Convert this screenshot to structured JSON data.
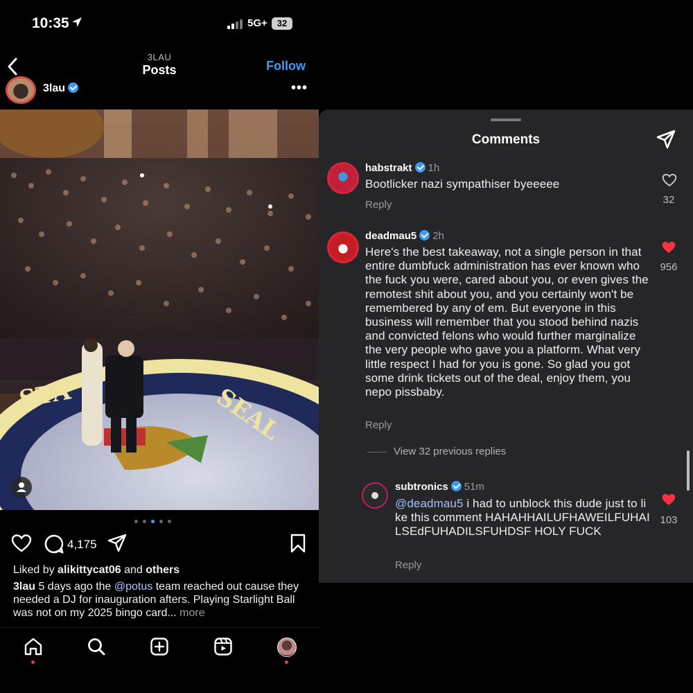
{
  "status_bar": {
    "time": "10:35",
    "network": "5G+",
    "battery": "32"
  },
  "header": {
    "subtitle": "3LAU",
    "title": "Posts",
    "follow_label": "Follow"
  },
  "post": {
    "author": "3lau",
    "more_label": "•••",
    "comment_count": "4,175",
    "liked_prefix": "Liked by ",
    "liked_user": "alikittycat06",
    "liked_mid": " and ",
    "liked_others": "others",
    "caption_user": "3lau",
    "caption_part1": " 5 days ago the ",
    "caption_mention": "@potus",
    "caption_part2": " team reached out cause they needed a DJ for inauguration afters. Playing Starlight Ball was not on my 2025 bingo card...",
    "caption_more": " more",
    "carousel_total": 5,
    "carousel_active": 2
  },
  "comments_panel": {
    "title": "Comments",
    "view_replies": "View 32 previous replies",
    "items": [
      {
        "user": "habstrakt",
        "time": "1h",
        "text": "Bootlicker nazi sympathiser byeeeee",
        "reply_label": "Reply",
        "likes": "32",
        "liked": false
      },
      {
        "user": "deadmau5",
        "time": "2h",
        "text": "Here's the best takeaway, not a single person in that entire dumbfuck administration has ever known who the fuck you were, cared about you, or even gives the remotest shit about you, and you certainly won't be remembered by any of em. But everyone in this business will remember that you stood behind nazis and convicted felons who would further marginalize the very people who gave you a platform. What very little respect I had for you is gone.  So glad you got some drink tickets out of the deal, enjoy them, you nepo pissbaby.",
        "reply_label": "Reply",
        "likes": "956",
        "liked": true
      },
      {
        "user": "subtronics",
        "time": "51m",
        "mention": "@deadmau5",
        "text": " i had to unblock this dude just to like this comment HAHAHHAILUFHAWEILFUHAILSEdFUHADILSFUHDSF HOLY FUCK",
        "reply_label": "Reply",
        "likes": "103",
        "liked": true
      }
    ]
  },
  "colors": {
    "accent": "#3c9bf5",
    "like_red": "#ff3040",
    "panel_bg": "#262628"
  }
}
